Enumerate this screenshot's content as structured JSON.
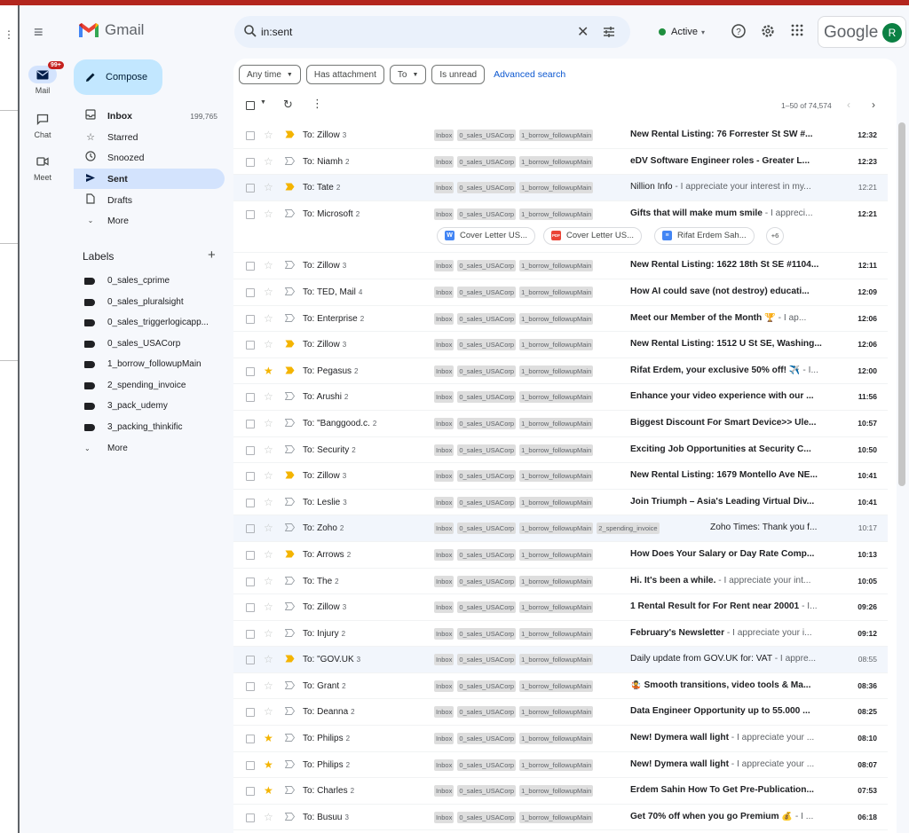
{
  "header": {
    "app_name": "Gmail",
    "search_value": "in:sent",
    "status": "Active",
    "google_wordmark": "Google",
    "avatar_initial": "R"
  },
  "rail": {
    "mail_label": "Mail",
    "mail_badge": "99+",
    "chat_label": "Chat",
    "meet_label": "Meet"
  },
  "sidebar": {
    "compose": "Compose",
    "nav": [
      {
        "label": "Inbox",
        "count": "199,765"
      },
      {
        "label": "Starred",
        "count": ""
      },
      {
        "label": "Snoozed",
        "count": ""
      },
      {
        "label": "Sent",
        "count": ""
      },
      {
        "label": "Drafts",
        "count": ""
      },
      {
        "label": "More",
        "count": ""
      }
    ],
    "labels_title": "Labels",
    "labels": [
      "0_sales_cprime",
      "0_sales_pluralsight",
      "0_sales_triggerlogicapp...",
      "0_sales_USACorp",
      "1_borrow_followupMain",
      "2_spending_invoice",
      "3_pack_udemy",
      "3_packing_thinkific"
    ],
    "labels_more": "More"
  },
  "filters": {
    "any_time": "Any time",
    "has_attachment": "Has attachment",
    "to": "To",
    "is_unread": "Is unread",
    "advanced": "Advanced search"
  },
  "toolbar": {
    "range": "1–50 of 74,574"
  },
  "emails": [
    {
      "to": "To: Zillow",
      "count": "3",
      "star": false,
      "important": true,
      "tags": [
        "Inbox",
        "0_sales_USACorp",
        "1_borrow_followupMain"
      ],
      "subject": "New Rental Listing: 76 Forrester St SW #...",
      "snippet": "",
      "time": "12:32",
      "read": false
    },
    {
      "to": "To: Niamh",
      "count": "2",
      "star": false,
      "important": false,
      "tags": [
        "Inbox",
        "0_sales_USACorp",
        "1_borrow_followupMain"
      ],
      "subject": "eDV Software Engineer roles - Greater L...",
      "snippet": "",
      "time": "12:23",
      "read": false
    },
    {
      "to": "To: Tate",
      "count": "2",
      "star": false,
      "important": true,
      "tags": [
        "Inbox",
        "0_sales_USACorp",
        "1_borrow_followupMain"
      ],
      "subject": "Nillion Info",
      "snippet": " - I appreciate your interest in my...",
      "time": "12:21",
      "read": true
    },
    {
      "to": "To: Microsoft",
      "count": "2",
      "star": false,
      "important": false,
      "tags": [
        "Inbox",
        "0_sales_USACorp",
        "1_borrow_followupMain"
      ],
      "subject": "Gifts that will make mum smile",
      "snippet": " - I appreci...",
      "time": "12:21",
      "read": false,
      "attachments": [
        "Cover Letter US...",
        "Cover Letter US...",
        "Rifat Erdem Sah..."
      ],
      "attachments_more": "+6"
    },
    {
      "to": "To: Zillow",
      "count": "3",
      "star": false,
      "important": false,
      "tags": [
        "Inbox",
        "0_sales_USACorp",
        "1_borrow_followupMain"
      ],
      "subject": "New Rental Listing: 1622 18th St SE #1104...",
      "snippet": "",
      "time": "12:11",
      "read": false
    },
    {
      "to": "To: TED, Mail",
      "count": "4",
      "star": false,
      "important": false,
      "tags": [
        "Inbox",
        "0_sales_USACorp",
        "1_borrow_followupMain"
      ],
      "subject": "How AI could save (not destroy) educati...",
      "snippet": "",
      "time": "12:09",
      "read": false
    },
    {
      "to": "To: Enterprise",
      "count": "2",
      "star": false,
      "important": false,
      "tags": [
        "Inbox",
        "0_sales_USACorp",
        "1_borrow_followupMain"
      ],
      "subject": "Meet our Member of the Month 🏆",
      "snippet": " - I ap...",
      "time": "12:06",
      "read": false
    },
    {
      "to": "To: Zillow",
      "count": "3",
      "star": false,
      "important": true,
      "tags": [
        "Inbox",
        "0_sales_USACorp",
        "1_borrow_followupMain"
      ],
      "subject": "New Rental Listing: 1512 U St SE, Washing...",
      "snippet": "",
      "time": "12:06",
      "read": false
    },
    {
      "to": "To: Pegasus",
      "count": "2",
      "star": true,
      "important": true,
      "tags": [
        "Inbox",
        "0_sales_USACorp",
        "1_borrow_followupMain"
      ],
      "subject": "Rifat Erdem, your exclusive 50% off! ✈️",
      "snippet": " - I...",
      "time": "12:00",
      "read": false
    },
    {
      "to": "To: Arushi",
      "count": "2",
      "star": false,
      "important": false,
      "tags": [
        "Inbox",
        "0_sales_USACorp",
        "1_borrow_followupMain"
      ],
      "subject": "Enhance your video experience with our ...",
      "snippet": "",
      "time": "11:56",
      "read": false
    },
    {
      "to": "To: \"Banggood.c.",
      "count": "2",
      "star": false,
      "important": false,
      "tags": [
        "Inbox",
        "0_sales_USACorp",
        "1_borrow_followupMain"
      ],
      "subject": "Biggest Discount For Smart Device>> Ule...",
      "snippet": "",
      "time": "10:57",
      "read": false
    },
    {
      "to": "To: Security",
      "count": "2",
      "star": false,
      "important": false,
      "tags": [
        "Inbox",
        "0_sales_USACorp",
        "1_borrow_followupMain"
      ],
      "subject": "Exciting Job Opportunities at Security C...",
      "snippet": "",
      "time": "10:50",
      "read": false
    },
    {
      "to": "To: Zillow",
      "count": "3",
      "star": false,
      "important": true,
      "tags": [
        "Inbox",
        "0_sales_USACorp",
        "1_borrow_followupMain"
      ],
      "subject": "New Rental Listing: 1679 Montello Ave NE...",
      "snippet": "",
      "time": "10:41",
      "read": false
    },
    {
      "to": "To: Leslie",
      "count": "3",
      "star": false,
      "important": false,
      "tags": [
        "Inbox",
        "0_sales_USACorp",
        "1_borrow_followupMain"
      ],
      "subject": "Join Triumph – Asia's Leading Virtual Div...",
      "snippet": "",
      "time": "10:41",
      "read": false
    },
    {
      "to": "To: Zoho",
      "count": "2",
      "star": false,
      "important": false,
      "tags": [
        "Inbox",
        "0_sales_USACorp",
        "1_borrow_followupMain",
        "2_spending_invoice"
      ],
      "subject": "Zoho Times: Thank you f...",
      "snippet": "",
      "time": "10:17",
      "read": true
    },
    {
      "to": "To: Arrows",
      "count": "2",
      "star": false,
      "important": true,
      "tags": [
        "Inbox",
        "0_sales_USACorp",
        "1_borrow_followupMain"
      ],
      "subject": "How Does Your Salary or Day Rate Comp...",
      "snippet": "",
      "time": "10:13",
      "read": false
    },
    {
      "to": "To: The",
      "count": "2",
      "star": false,
      "important": false,
      "tags": [
        "Inbox",
        "0_sales_USACorp",
        "1_borrow_followupMain"
      ],
      "subject": "Hi. It's been a while.",
      "snippet": " - I appreciate your int...",
      "time": "10:05",
      "read": false
    },
    {
      "to": "To: Zillow",
      "count": "3",
      "star": false,
      "important": false,
      "tags": [
        "Inbox",
        "0_sales_USACorp",
        "1_borrow_followupMain"
      ],
      "subject": "1 Rental Result for For Rent near 20001",
      "snippet": " - I...",
      "time": "09:26",
      "read": false
    },
    {
      "to": "To: Injury",
      "count": "2",
      "star": false,
      "important": false,
      "tags": [
        "Inbox",
        "0_sales_USACorp",
        "1_borrow_followupMain"
      ],
      "subject": "February's Newsletter",
      "snippet": " - I appreciate your i...",
      "time": "09:12",
      "read": false
    },
    {
      "to": "To: \"GOV.UK",
      "count": "3",
      "star": false,
      "important": true,
      "tags": [
        "Inbox",
        "0_sales_USACorp",
        "1_borrow_followupMain"
      ],
      "subject": "Daily update from GOV.UK for: VAT",
      "snippet": " - I appre...",
      "time": "08:55",
      "read": true
    },
    {
      "to": "To: Grant",
      "count": "2",
      "star": false,
      "important": false,
      "tags": [
        "Inbox",
        "0_sales_USACorp",
        "1_borrow_followupMain"
      ],
      "subject": "🤹 Smooth transitions, video tools & Ma...",
      "snippet": "",
      "time": "08:36",
      "read": false
    },
    {
      "to": "To: Deanna",
      "count": "2",
      "star": false,
      "important": false,
      "tags": [
        "Inbox",
        "0_sales_USACorp",
        "1_borrow_followupMain"
      ],
      "subject": "Data Engineer Opportunity up to 55.000 ...",
      "snippet": "",
      "time": "08:25",
      "read": false
    },
    {
      "to": "To: Philips",
      "count": "2",
      "star": true,
      "important": false,
      "tags": [
        "Inbox",
        "0_sales_USACorp",
        "1_borrow_followupMain"
      ],
      "subject": "New! Dymera wall light",
      "snippet": " - I appreciate your ...",
      "time": "08:10",
      "read": false
    },
    {
      "to": "To: Philips",
      "count": "2",
      "star": true,
      "important": false,
      "tags": [
        "Inbox",
        "0_sales_USACorp",
        "1_borrow_followupMain"
      ],
      "subject": "New! Dymera wall light",
      "snippet": " - I appreciate your ...",
      "time": "08:07",
      "read": false
    },
    {
      "to": "To: Charles",
      "count": "2",
      "star": true,
      "important": false,
      "tags": [
        "Inbox",
        "0_sales_USACorp",
        "1_borrow_followupMain"
      ],
      "subject": "Erdem Sahin How To Get Pre-Publication...",
      "snippet": "",
      "time": "07:53",
      "read": false
    },
    {
      "to": "To: Busuu",
      "count": "3",
      "star": false,
      "important": false,
      "tags": [
        "Inbox",
        "0_sales_USACorp",
        "1_borrow_followupMain"
      ],
      "subject": "Get 70% off when you go Premium 💰",
      "snippet": " - I ...",
      "time": "06:18",
      "read": false
    }
  ],
  "colors": {
    "accent": "#0b57d0",
    "compose_bg": "#c2e7ff",
    "active_nav": "#d3e3fd",
    "star": "#f4b400",
    "important": "#f4b400"
  }
}
